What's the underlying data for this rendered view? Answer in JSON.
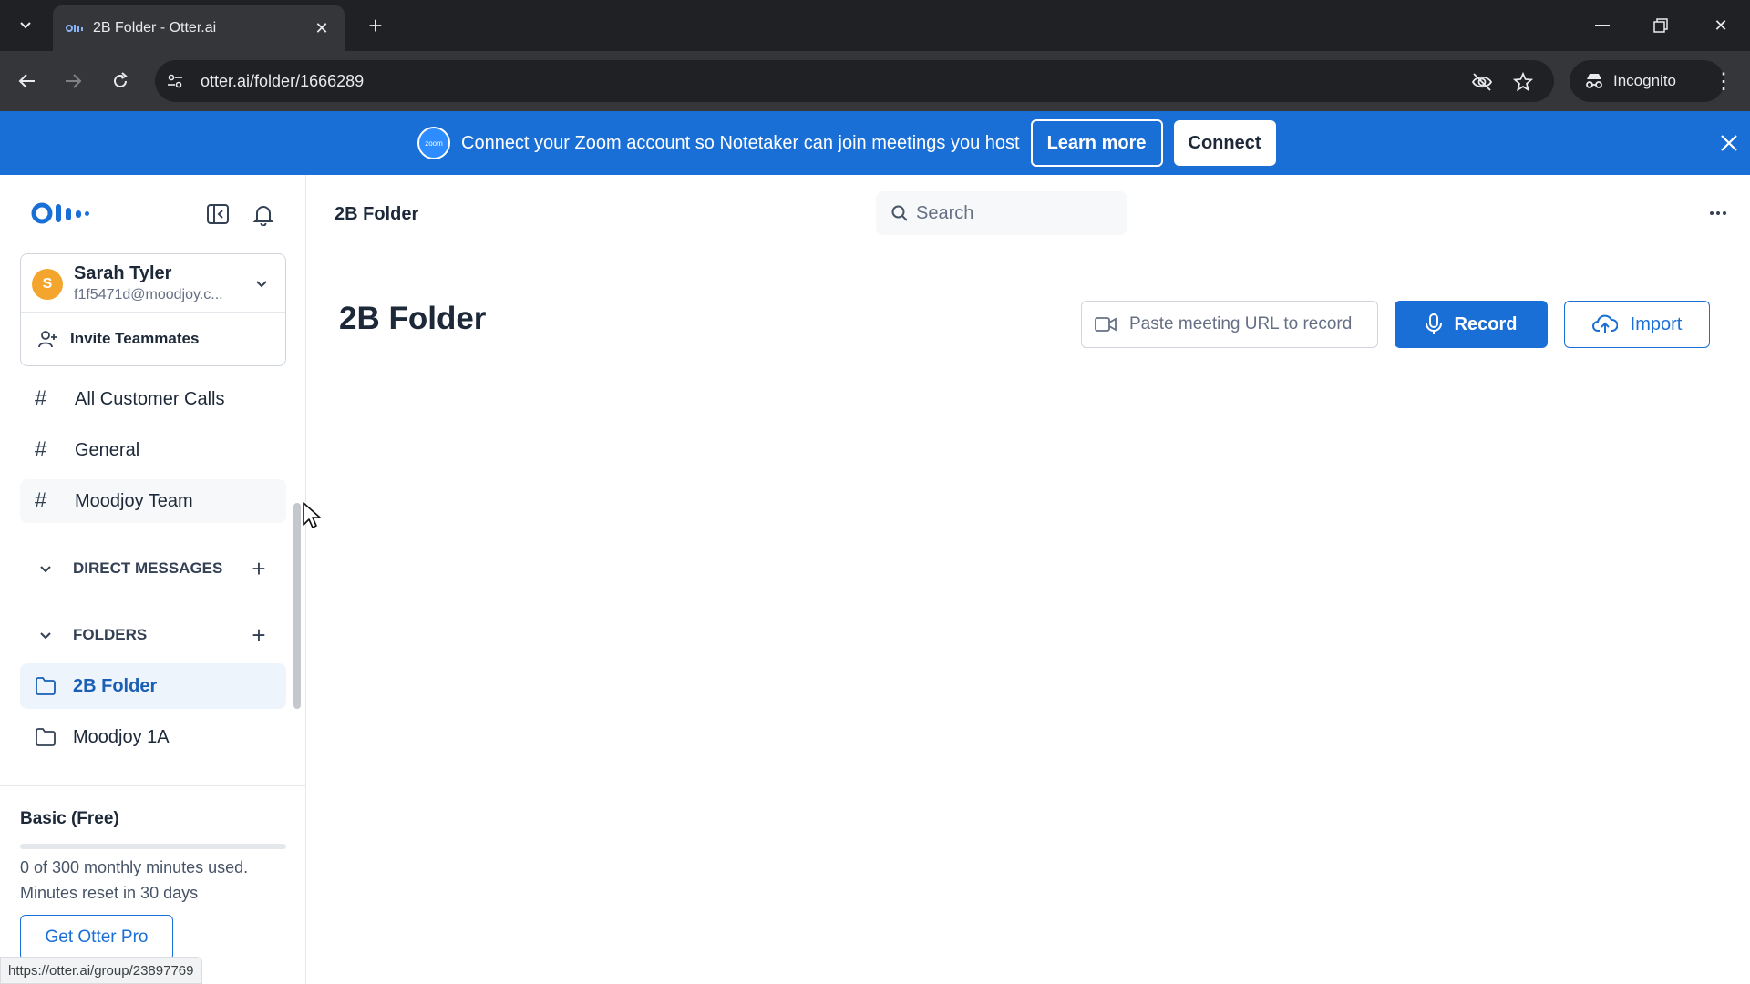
{
  "browser": {
    "tab_title": "2B Folder - Otter.ai",
    "url": "otter.ai/folder/1666289",
    "incognito_label": "Incognito",
    "status_url": "https://otter.ai/group/23897769"
  },
  "banner": {
    "zoom_logo_text": "zoom",
    "message": "Connect your Zoom account so Notetaker can join meetings you host",
    "learn_more": "Learn more",
    "connect": "Connect",
    "color": "#1a6fd6"
  },
  "user": {
    "initial": "S",
    "name": "Sarah Tyler",
    "email": "f1f5471d@moodjoy.c...",
    "invite_label": "Invite Teammates"
  },
  "channels": [
    {
      "label": "All Customer Calls"
    },
    {
      "label": "General"
    },
    {
      "label": "Moodjoy Team"
    }
  ],
  "sections": {
    "direct_messages": "DIRECT MESSAGES",
    "folders": "FOLDERS"
  },
  "folders": [
    {
      "label": "2B Folder",
      "active": true
    },
    {
      "label": "Moodjoy 1A",
      "active": false
    }
  ],
  "plan": {
    "title": "Basic (Free)",
    "usage_line1": "0 of 300 monthly minutes used.",
    "usage_line2": "Minutes reset in 30 days",
    "usage_fraction": 0,
    "cta": "Get Otter Pro"
  },
  "header": {
    "title": "2B Folder",
    "search_placeholder": "Search"
  },
  "main": {
    "page_title": "2B Folder",
    "url_placeholder": "Paste meeting URL to record",
    "record_label": "Record",
    "import_label": "Import"
  },
  "colors": {
    "accent": "#1a6fd6",
    "avatar": "#f4a52e"
  }
}
